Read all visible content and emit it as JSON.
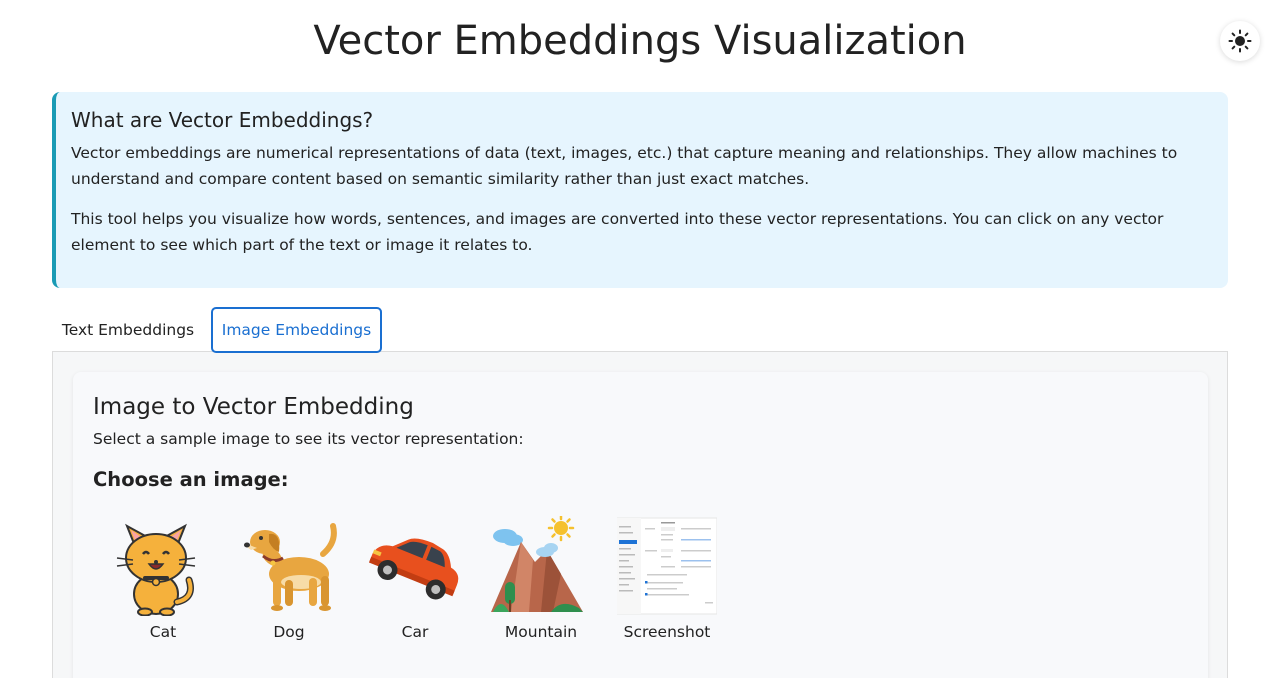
{
  "header": {
    "title": "Vector Embeddings Visualization",
    "theme_icon": "sun-icon"
  },
  "info": {
    "title": "What are Vector Embeddings?",
    "paragraph1": "Vector embeddings are numerical representations of data (text, images, etc.) that capture meaning and relationships. They allow machines to understand and compare content based on semantic similarity rather than just exact matches.",
    "paragraph2": "This tool helps you visualize how words, sentences, and images are converted into these vector representations. You can click on any vector element to see which part of the text or image it relates to."
  },
  "tabs": [
    {
      "label": "Text Embeddings",
      "active": false
    },
    {
      "label": "Image Embeddings",
      "active": true
    }
  ],
  "image_panel": {
    "title": "Image to Vector Embedding",
    "subtitle": "Select a sample image to see its vector representation:",
    "choose_label": "Choose an image:",
    "images": [
      {
        "label": "Cat",
        "icon": "cat-icon"
      },
      {
        "label": "Dog",
        "icon": "dog-icon"
      },
      {
        "label": "Car",
        "icon": "car-icon"
      },
      {
        "label": "Mountain",
        "icon": "mountain-icon"
      },
      {
        "label": "Screenshot",
        "icon": "screenshot-thumbnail"
      }
    ]
  },
  "colors": {
    "accent": "#1a6fd1",
    "info_bg": "#e6f5fe",
    "info_border": "#1a9bb5"
  }
}
